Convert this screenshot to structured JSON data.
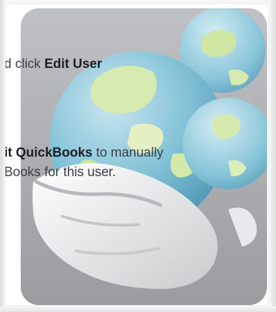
{
  "instructions": {
    "line1": {
      "prefix": "d click ",
      "bold": "Edit User",
      "suffix": ""
    },
    "line2": {
      "prefix": "",
      "bold": "it QuickBooks",
      "suffix": " to manually"
    },
    "line3": {
      "prefix": "Books for this user.",
      "bold": "",
      "suffix": ""
    }
  },
  "illustration": {
    "icon": "globe-icon"
  }
}
